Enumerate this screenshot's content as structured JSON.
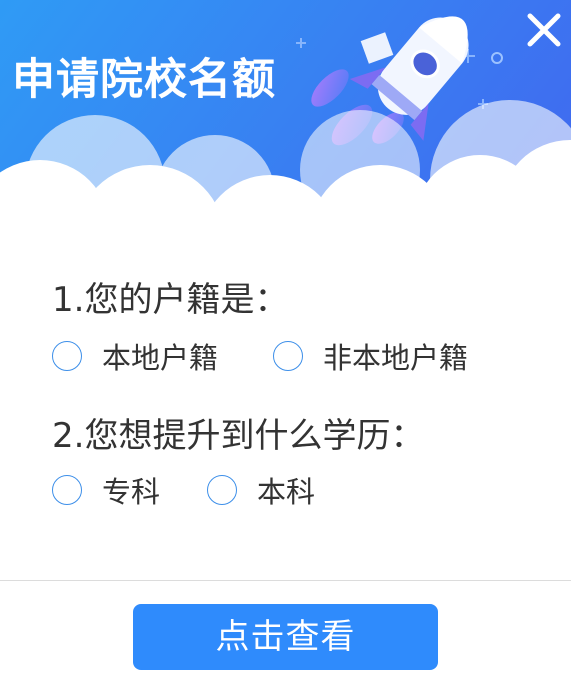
{
  "dialog": {
    "title": "申请院校名额",
    "close_icon": "close-icon",
    "accent_color": "#2f8bfc"
  },
  "questions": [
    {
      "label": "1.您的户籍是：",
      "options": [
        "本地户籍",
        "非本地户籍"
      ]
    },
    {
      "label": "2.您想提升到什么学历：",
      "options": [
        "专科",
        "本科"
      ]
    }
  ],
  "submit_label": "点击查看"
}
